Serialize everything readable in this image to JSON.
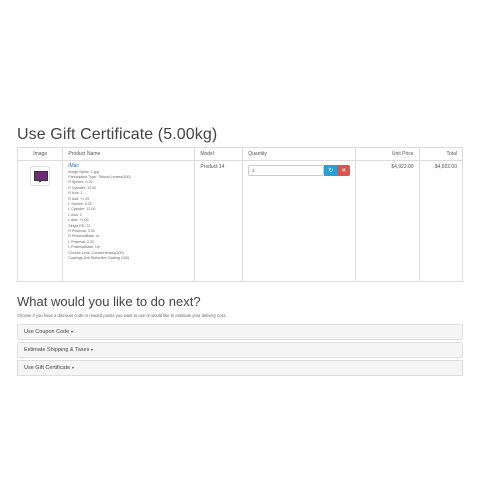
{
  "page": {
    "title": "Use Gift Certificate  (5.00kg)"
  },
  "cart": {
    "columns": [
      "Image",
      "Product Name",
      "Model",
      "Quantity",
      "Unit Price",
      "Total"
    ],
    "item": {
      "image_icon": "monitor-icon",
      "name": "iMac",
      "options": [
        "Image Name: 1.jpg",
        "Prescription Type: Trifocal Lenses(500)",
        "R Sphere: 0.25",
        "R Cylinder: 12.00",
        "R Axis: 2",
        "R Add: +1.25",
        "L Sphere: 0.25",
        "L Cylinder: 12.00",
        "L Axis: 3",
        "L Add: +1.00",
        "Single PD: 72",
        "R Prismval: 3.00",
        "R PrismvalBase: In",
        "L Prismval: 2.00",
        "L PrismvalBase: Up",
        "Choose Lens: Contact lenses(300)",
        "Coatings:Anti Reflective Coating (150)"
      ],
      "model": "Product 14",
      "quantity": "1",
      "unit_price": "$4,922.00",
      "total": "$4,922.00"
    },
    "refresh_icon": "refresh-icon",
    "remove_icon": "close-icon",
    "colors": {
      "refresh": "#2a9fd6",
      "remove": "#d9534f",
      "link": "#2a6ebb"
    }
  },
  "next": {
    "title": "What would you like to do next?",
    "description": "Choose if you have a discount code or reward points you want to use or would like to estimate your delivery cost.",
    "panels": [
      {
        "label": "Use Coupon Code"
      },
      {
        "label": "Estimate Shipping & Taxes"
      },
      {
        "label": "Use Gift Certificate"
      }
    ]
  }
}
